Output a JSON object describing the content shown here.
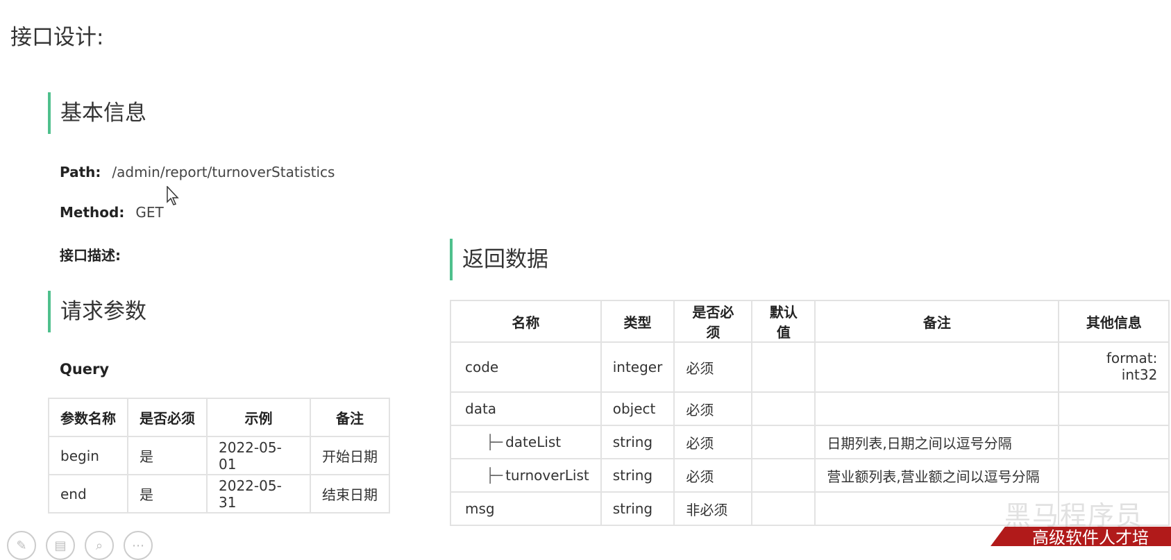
{
  "page_title": "接口设计:",
  "basic_info": {
    "heading": "基本信息",
    "path_label": "Path:",
    "path_value": "/admin/report/turnoverStatistics",
    "method_label": "Method:",
    "method_value": "GET",
    "description_label": "接口描述:"
  },
  "request_params": {
    "heading": "请求参数",
    "query_label": "Query",
    "columns": [
      "参数名称",
      "是否必须",
      "示例",
      "备注"
    ],
    "rows": [
      [
        "begin",
        "是",
        "2022-05-01",
        "开始日期"
      ],
      [
        "end",
        "是",
        "2022-05-31",
        "结束日期"
      ]
    ]
  },
  "return_data": {
    "heading": "返回数据",
    "columns": [
      "名称",
      "类型",
      "是否必须",
      "默认值",
      "备注",
      "其他信息"
    ],
    "rows": [
      {
        "tree": "",
        "name": "code",
        "type": "integer",
        "required": "必须",
        "default": "",
        "note": "",
        "other": "format: int32"
      },
      {
        "tree": "",
        "name": "data",
        "type": "object",
        "required": "必须",
        "default": "",
        "note": "",
        "other": ""
      },
      {
        "tree": "├─",
        "name": "dateList",
        "type": "string",
        "required": "必须",
        "default": "",
        "note": "日期列表,日期之间以逗号分隔",
        "other": ""
      },
      {
        "tree": "├─",
        "name": "turnoverList",
        "type": "string",
        "required": "必须",
        "default": "",
        "note": "营业额列表,营业额之间以逗号分隔",
        "other": ""
      },
      {
        "tree": "",
        "name": "msg",
        "type": "string",
        "required": "非必须",
        "default": "",
        "note": "",
        "other": ""
      }
    ]
  },
  "overlay": {
    "watermark": "黑马程序员",
    "banner": "高级软件人才培"
  },
  "toolbar_icons": [
    "pencil-icon",
    "layout-icon",
    "zoom-icon",
    "more-icon"
  ]
}
